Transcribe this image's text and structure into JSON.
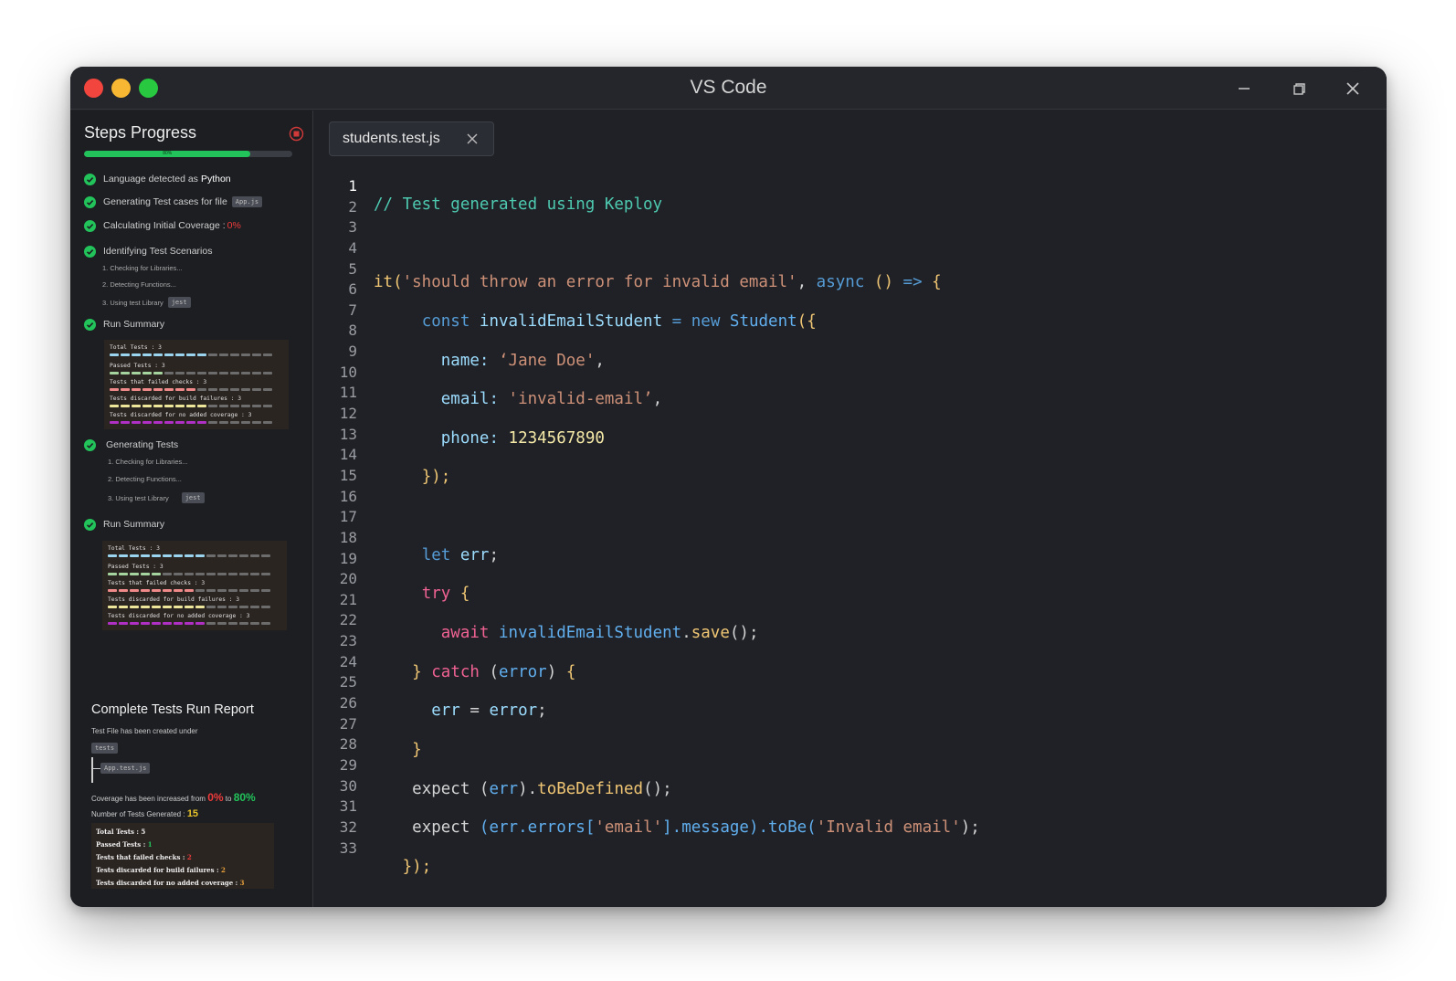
{
  "window": {
    "title": "VS Code"
  },
  "sidebar": {
    "title": "Steps Progress",
    "progress": {
      "percent": 80,
      "label": "80%"
    },
    "steps": [
      {
        "text": "Language detected as",
        "highlight": "Python"
      },
      {
        "text": "Generating Test cases for file",
        "chip": "App.js"
      },
      {
        "text": "Calculating Initial Coverage :",
        "value": "0%"
      },
      {
        "text": "Identifying Test Scenarios"
      },
      {
        "text": "Run Summary"
      },
      {
        "text": "Generating Tests"
      },
      {
        "text": "Run Summary"
      }
    ],
    "substeps_a": [
      "1. Checking for Libraries...",
      "2. Detecting Functions...",
      "3. Using test Library"
    ],
    "substeps_a_chip": "jest",
    "substeps_b": [
      "1. Checking for Libraries...",
      "2. Detecting Functions...",
      "3. Using test Library"
    ],
    "substeps_b_chip": "jest",
    "summary": {
      "lines": [
        "Total Tests : 3",
        "Passed Tests : 3",
        "Tests that failed checks : 3",
        "Tests discarded for build failures : 3",
        "Tests discarded for no added coverage : 3"
      ],
      "bar_colors": [
        "#9bd4ee",
        "#a6d49f",
        "#f08a8a",
        "#ece59a",
        "#b02fc4"
      ]
    },
    "report": {
      "title": "Complete Tests Run Report",
      "subtitle": "Test File has been created under",
      "folder": "tests",
      "file": "App.test.js",
      "coverage_prefix": "Coverage has been increased from",
      "coverage_from": "0%",
      "coverage_mid": "to",
      "coverage_to": "80%",
      "num_prefix": "Number of Tests Generated :",
      "num_value": "15",
      "final": {
        "total": "Total Tests : 5",
        "passed_label": "Passed Tests :",
        "passed_value": "1",
        "failed_label": "Tests that failed checks :",
        "failed_value": "2",
        "build_label": "Tests discarded for build failures :",
        "build_value": "2",
        "coverage_label": "Tests discarded for no added coverage :",
        "coverage_value": "3"
      }
    }
  },
  "editor": {
    "tab_label": "students.test.js",
    "line_count": 33,
    "active_line": 1
  }
}
